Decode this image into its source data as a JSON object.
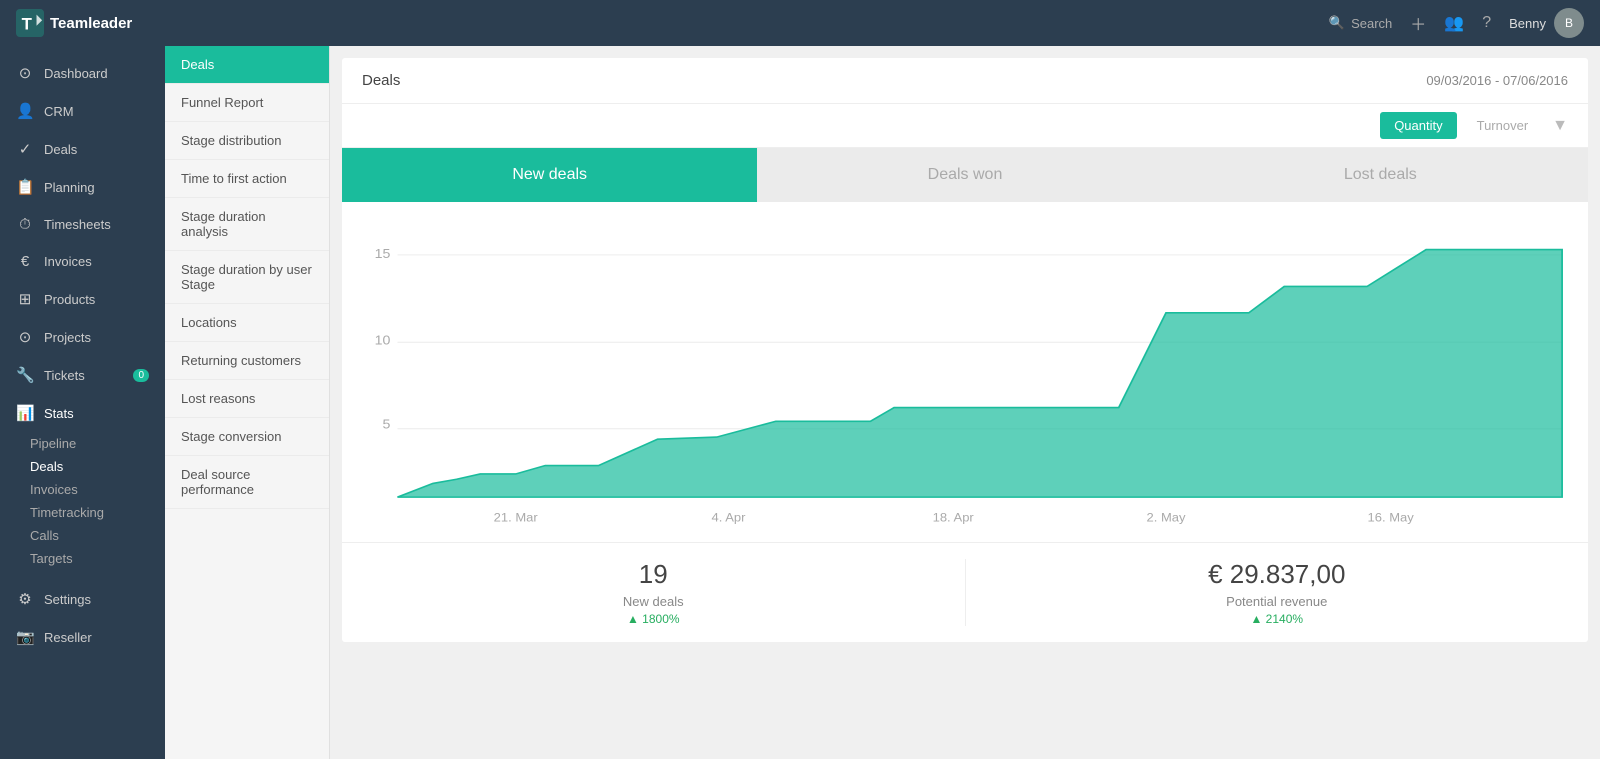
{
  "topnav": {
    "logo": "Teamleader",
    "search_placeholder": "Search",
    "user_name": "Benny"
  },
  "sidebar_left": {
    "items": [
      {
        "id": "dashboard",
        "label": "Dashboard",
        "icon": "⊙",
        "active": false
      },
      {
        "id": "crm",
        "label": "CRM",
        "icon": "👤",
        "active": false
      },
      {
        "id": "deals",
        "label": "Deals",
        "icon": "✓",
        "active": false
      },
      {
        "id": "planning",
        "label": "Planning",
        "icon": "📋",
        "active": false
      },
      {
        "id": "timesheets",
        "label": "Timesheets",
        "icon": "⏱",
        "active": false
      },
      {
        "id": "invoices",
        "label": "Invoices",
        "icon": "€",
        "active": false
      },
      {
        "id": "products",
        "label": "Products",
        "icon": "⊞",
        "active": false
      },
      {
        "id": "projects",
        "label": "Projects",
        "icon": "⊙",
        "active": false
      },
      {
        "id": "tickets",
        "label": "Tickets",
        "icon": "🔧",
        "badge": "0",
        "active": false
      },
      {
        "id": "stats",
        "label": "Stats",
        "icon": "📊",
        "active": true
      }
    ],
    "sub_items": [
      {
        "id": "pipeline",
        "label": "Pipeline",
        "active": false
      },
      {
        "id": "deals-sub",
        "label": "Deals",
        "active": true
      },
      {
        "id": "invoices-sub",
        "label": "Invoices",
        "active": false
      },
      {
        "id": "timetracking",
        "label": "Timetracking",
        "active": false
      },
      {
        "id": "calls",
        "label": "Calls",
        "active": false
      },
      {
        "id": "targets",
        "label": "Targets",
        "active": false
      }
    ],
    "bottom_items": [
      {
        "id": "settings",
        "label": "Settings",
        "icon": "⚙",
        "active": false
      },
      {
        "id": "reseller",
        "label": "Reseller",
        "icon": "📷",
        "active": false
      }
    ]
  },
  "sidebar_reports": {
    "items": [
      {
        "id": "deals-report",
        "label": "Deals",
        "active": true
      },
      {
        "id": "funnel-report",
        "label": "Funnel Report",
        "active": false
      },
      {
        "id": "stage-distribution",
        "label": "Stage distribution",
        "active": false
      },
      {
        "id": "time-to-first-action",
        "label": "Time to first action",
        "active": false
      },
      {
        "id": "stage-duration-analysis",
        "label": "Stage duration analysis",
        "active": false
      },
      {
        "id": "stage-duration-by-user",
        "label": "Stage duration by user Stage",
        "active": false
      },
      {
        "id": "locations",
        "label": "Locations",
        "active": false
      },
      {
        "id": "returning-customers",
        "label": "Returning customers",
        "active": false
      },
      {
        "id": "lost-reasons",
        "label": "Lost reasons",
        "active": false
      },
      {
        "id": "stage-conversion",
        "label": "Stage conversion",
        "active": false
      },
      {
        "id": "deal-source-performance",
        "label": "Deal source performance",
        "active": false
      }
    ]
  },
  "main": {
    "title": "Deals",
    "date_range": "09/03/2016 - 07/06/2016",
    "toolbar": {
      "quantity_label": "Quantity",
      "turnover_label": "Turnover"
    },
    "tabs": [
      {
        "id": "new-deals",
        "label": "New deals",
        "active": true
      },
      {
        "id": "deals-won",
        "label": "Deals won",
        "active": false
      },
      {
        "id": "lost-deals",
        "label": "Lost deals",
        "active": false
      }
    ],
    "chart": {
      "y_labels": [
        "15",
        "10",
        "5"
      ],
      "x_labels": [
        "21. Mar",
        "4. Apr",
        "18. Apr",
        "2. May",
        "16. May"
      ],
      "color": "#1abc9c"
    },
    "stats": [
      {
        "id": "new-deals-stat",
        "value": "19",
        "label": "New deals",
        "change": "1800%"
      },
      {
        "id": "potential-revenue-stat",
        "value": "€ 29.837,00",
        "label": "Potential revenue",
        "change": "2140%"
      }
    ]
  }
}
